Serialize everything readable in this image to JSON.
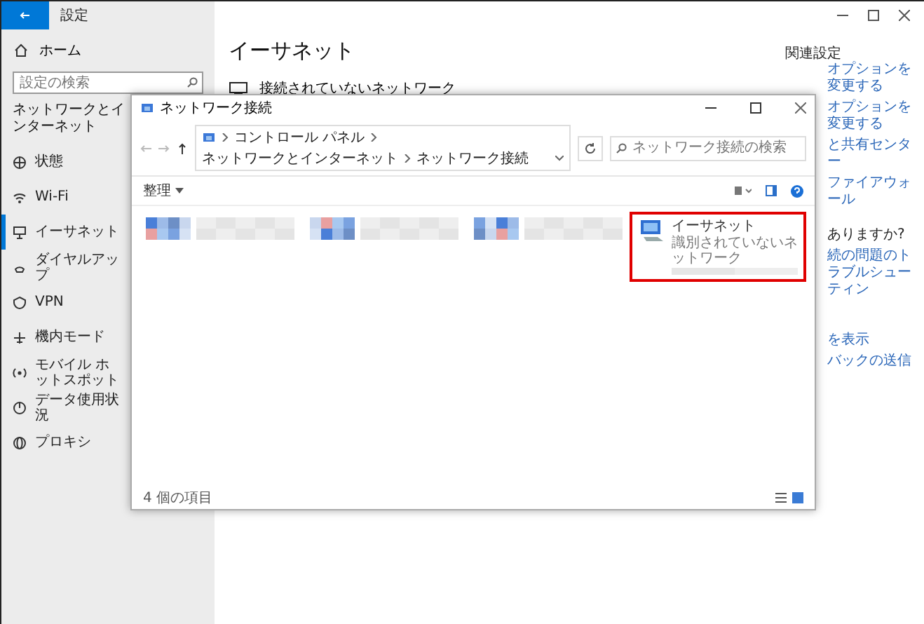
{
  "settings_window": {
    "title": "設定",
    "sidebar": {
      "home": "ホーム",
      "search": {
        "placeholder": "設定の検索"
      },
      "section": "ネットワークとインターネット",
      "items": [
        {
          "label": "状態",
          "selected": false
        },
        {
          "label": "Wi-Fi",
          "selected": false
        },
        {
          "label": "イーサネット",
          "selected": true
        },
        {
          "label": "ダイヤルアップ",
          "selected": false
        },
        {
          "label": "VPN",
          "selected": false
        },
        {
          "label": "機内モード",
          "selected": false
        },
        {
          "label": "モバイル ホットスポット",
          "selected": false
        },
        {
          "label": "データ使用状況",
          "selected": false
        },
        {
          "label": "プロキシ",
          "selected": false
        }
      ]
    },
    "main": {
      "heading": "イーサネット",
      "network": "接続されていないネットワーク"
    },
    "right_panel": {
      "heading": "関連設定",
      "links": [
        "オプションを変更する",
        "オプションを変更する",
        "と共有センター",
        "ファイアウォール"
      ],
      "question": "ありますか?",
      "help_links": [
        "続の問題のトラブルシューティン"
      ],
      "footer_links": [
        "を表示",
        "バックの送信"
      ]
    }
  },
  "explorer_window": {
    "title": "ネットワーク接続",
    "breadcrumb": [
      "コントロール パネル",
      "ネットワークとインターネット",
      "ネットワーク接続"
    ],
    "search": {
      "placeholder": "ネットワーク接続の検索"
    },
    "organize": "整理",
    "items": [
      {
        "kind": "redacted"
      },
      {
        "kind": "redacted"
      },
      {
        "kind": "redacted"
      },
      {
        "kind": "adapter",
        "name": "イーサネット",
        "status": "識別されていないネットワーク",
        "highlighted": true
      }
    ],
    "status_bar": "4 個の項目"
  }
}
